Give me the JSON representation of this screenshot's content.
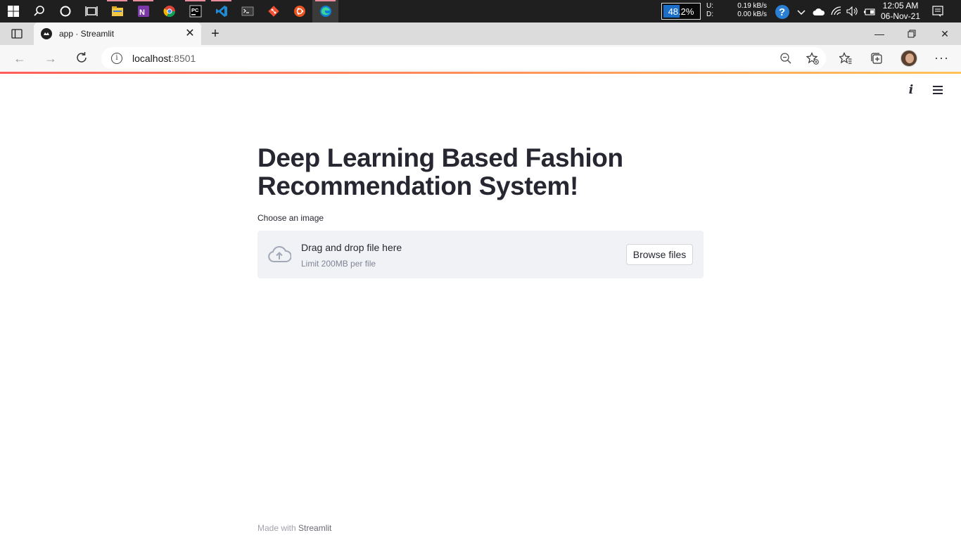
{
  "taskbar": {
    "apps": [
      {
        "name": "windows-start",
        "running": false,
        "active": false
      },
      {
        "name": "search",
        "running": false,
        "active": false
      },
      {
        "name": "cortana",
        "running": false,
        "active": false
      },
      {
        "name": "task-view",
        "running": false,
        "active": false
      },
      {
        "name": "file-explorer",
        "running": true,
        "active": false
      },
      {
        "name": "onenote",
        "running": true,
        "active": false
      },
      {
        "name": "chrome",
        "running": false,
        "active": false
      },
      {
        "name": "pycharm",
        "running": true,
        "active": false
      },
      {
        "name": "vscode",
        "running": true,
        "active": false
      },
      {
        "name": "terminal",
        "running": false,
        "active": false
      },
      {
        "name": "git",
        "running": false,
        "active": false
      },
      {
        "name": "ubuntu",
        "running": false,
        "active": false
      },
      {
        "name": "edge",
        "running": true,
        "active": true
      }
    ],
    "battery_percent": "48.2%",
    "battery_level": 0.44,
    "upload_label": "U:",
    "download_label": "D:",
    "upload_speed": "0.19 kB/s",
    "download_speed": "0.00 kB/s",
    "time": "12:05 AM",
    "date": "06-Nov-21"
  },
  "browser": {
    "tab_title": "app · Streamlit",
    "url_host": "localhost",
    "url_port": ":8501"
  },
  "app": {
    "title": "Deep Learning Based Fashion Recommendation System!",
    "uploader_label": "Choose an image",
    "dropzone_text": "Drag and drop file here",
    "dropzone_limit": "Limit 200MB per file",
    "browse_button": "Browse files",
    "footer_prefix": "Made with",
    "footer_brand": "Streamlit"
  },
  "colors": {
    "text": "#262730",
    "dropzone_bg": "#f0f2f6",
    "decoration_start": "#ff4b4b",
    "decoration_end": "#ffbd45"
  }
}
